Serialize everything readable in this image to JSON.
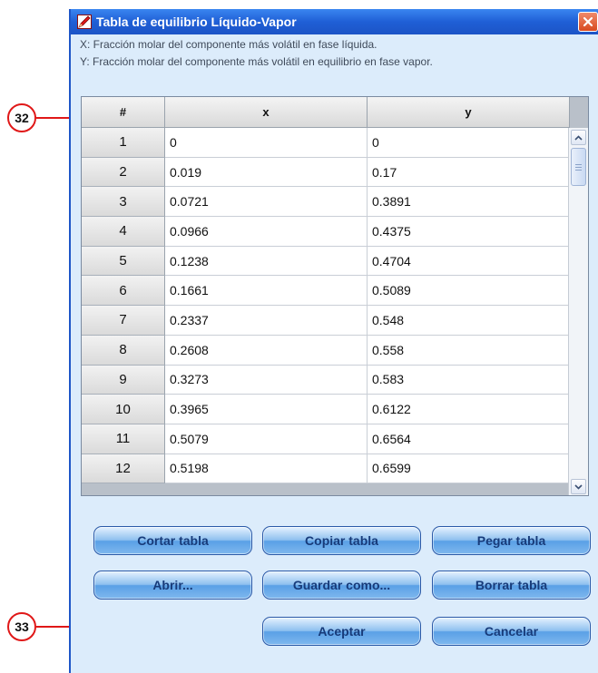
{
  "window": {
    "title": "Tabla de equilibrio Líquido-Vapor",
    "close_symbol": "✕"
  },
  "description": {
    "line_x": "X: Fracción molar del componente más volátil en fase líquida.",
    "line_y": "Y: Fracción molar del componente más volátil en equilibrio en fase vapor."
  },
  "table": {
    "headers": [
      "#",
      "x",
      "y"
    ],
    "rows": [
      {
        "n": "1",
        "x": "0",
        "y": "0"
      },
      {
        "n": "2",
        "x": "0.019",
        "y": "0.17"
      },
      {
        "n": "3",
        "x": "0.0721",
        "y": "0.3891"
      },
      {
        "n": "4",
        "x": "0.0966",
        "y": "0.4375"
      },
      {
        "n": "5",
        "x": "0.1238",
        "y": "0.4704"
      },
      {
        "n": "6",
        "x": "0.1661",
        "y": "0.5089"
      },
      {
        "n": "7",
        "x": "0.2337",
        "y": "0.548"
      },
      {
        "n": "8",
        "x": "0.2608",
        "y": "0.558"
      },
      {
        "n": "9",
        "x": "0.3273",
        "y": "0.583"
      },
      {
        "n": "10",
        "x": "0.3965",
        "y": "0.6122"
      },
      {
        "n": "11",
        "x": "0.5079",
        "y": "0.6564"
      },
      {
        "n": "12",
        "x": "0.5198",
        "y": "0.6599"
      }
    ]
  },
  "buttons": {
    "cut": "Cortar tabla",
    "copy": "Copiar tabla",
    "paste": "Pegar tabla",
    "open": "Abrir...",
    "save_as": "Guardar como...",
    "clear": "Borrar tabla",
    "ok": "Aceptar",
    "cancel": "Cancelar"
  },
  "callouts": {
    "top": "32",
    "bottom": "33"
  },
  "icons": {
    "app": "pencil-icon",
    "close": "close-icon",
    "scroll_up": "chevron-up-icon",
    "scroll_down": "chevron-down-icon"
  },
  "colors": {
    "titlebar": "#1f5fd6",
    "window_bg": "#dcecfb",
    "button": "#7fb8ee",
    "callout": "#e01818"
  }
}
